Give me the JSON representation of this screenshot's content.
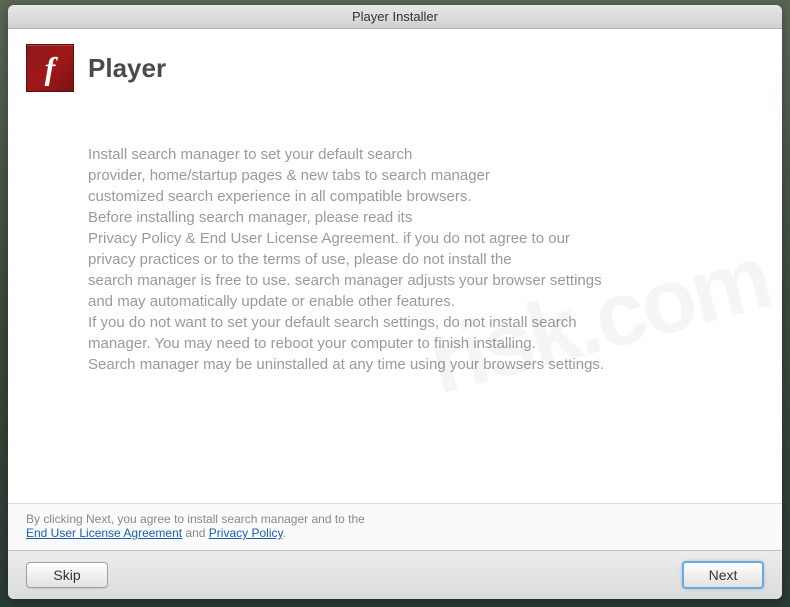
{
  "window": {
    "title": "Player Installer"
  },
  "header": {
    "icon_glyph": "f",
    "title": "Player"
  },
  "body": {
    "line1": "Install search manager to set your default search",
    "line2": "provider, home/startup pages & new tabs to search manager",
    "line3": "customized search experience in all compatible browsers.",
    "line4": "Before installing search manager, please read its",
    "line5": "Privacy Policy & End User License Agreement. if you do not agree to our",
    "line6": "privacy practices or to the terms of use, please do not install the",
    "line7": "search manager is free to use. search manager adjusts your browser settings",
    "line8": "and may automatically update or enable other features.",
    "line9": "If you do not want to set your default search settings, do not install search",
    "line10": "manager. You may need to reboot your computer to finish installing.",
    "line11": "Search manager may be uninstalled at any time using your browsers settings."
  },
  "footer": {
    "prefix": "By clicking Next, you agree to install search manager and to the",
    "eula_link": "End User License Agreement",
    "and": " and ",
    "privacy_link": "Privacy Policy",
    "suffix": "."
  },
  "buttons": {
    "skip": "Skip",
    "next": "Next"
  },
  "watermark": {
    "text": "risk.com"
  }
}
